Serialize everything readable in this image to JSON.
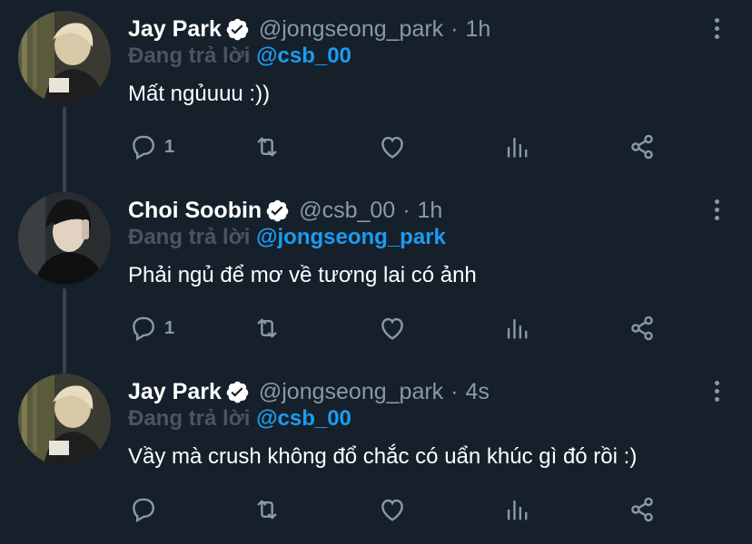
{
  "tweets": [
    {
      "name": "Jay Park",
      "handle": "@jongseong_park",
      "separator": "·",
      "time": "1h",
      "replying_prefix": "Đang trả lời",
      "replying_to": "@csb_00",
      "text": "Mất ngủuuu :))",
      "reply_count": "1",
      "icons": [
        "reply-icon",
        "retweet-icon",
        "like-icon",
        "views-icon",
        "share-icon"
      ]
    },
    {
      "name": "Choi Soobin",
      "handle": "@csb_00",
      "separator": "·",
      "time": "1h",
      "replying_prefix": "Đang trả lời",
      "replying_to": "@jongseong_park",
      "text": "Phải ngủ để mơ về tương lai có ảnh",
      "reply_count": "1",
      "icons": [
        "reply-icon",
        "retweet-icon",
        "like-icon",
        "views-icon",
        "share-icon"
      ]
    },
    {
      "name": "Jay Park",
      "handle": "@jongseong_park",
      "separator": "·",
      "time": "4s",
      "replying_prefix": "Đang trả lời",
      "replying_to": "@csb_00",
      "text": "Vầy mà crush không đổ chắc có uẩn khúc gì đó rồi :)",
      "reply_count": "",
      "icons": [
        "reply-icon",
        "retweet-icon",
        "like-icon",
        "views-icon",
        "share-icon"
      ]
    }
  ],
  "colors": {
    "background": "#15202b",
    "text_primary": "#ffffff",
    "text_secondary": "#8b98a5",
    "mention": "#1d9bf0",
    "thread_line": "#38444d"
  }
}
